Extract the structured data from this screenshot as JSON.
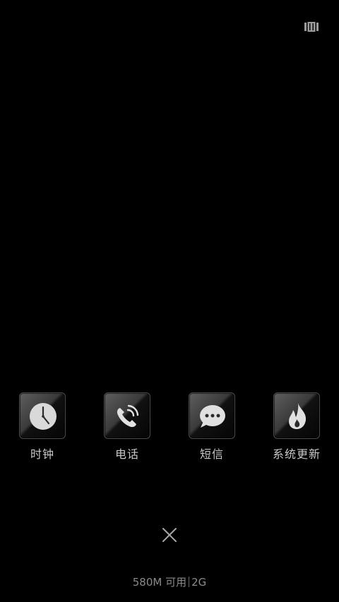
{
  "recents": {
    "apps": [
      {
        "label": "时钟",
        "icon": "clock-icon"
      },
      {
        "label": "电话",
        "icon": "phone-icon"
      },
      {
        "label": "短信",
        "icon": "message-icon"
      },
      {
        "label": "系统更新",
        "icon": "flame-icon"
      }
    ],
    "toggle_icon": "view-toggle-icon",
    "close_icon": "close-icon"
  },
  "memory": {
    "available": "580M 可用",
    "total": "2G"
  }
}
